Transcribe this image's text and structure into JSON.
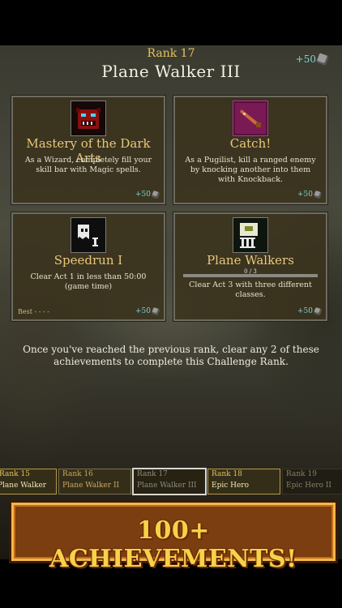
{
  "header": {
    "rank_label": "Rank 17",
    "title": "Plane Walker III",
    "points": "+50"
  },
  "achievements": [
    {
      "title": "Mastery of the Dark Arts",
      "desc": "As a Wizard, completely fill your skill bar with Magic spells.",
      "points": "+50",
      "icon": "demon-mask-icon"
    },
    {
      "title": "Catch!",
      "desc": "As a Pugilist, kill a ranged enemy by knocking another into them with Knockback.",
      "points": "+50",
      "icon": "thrown-dagger-icon"
    },
    {
      "title": "Speedrun I",
      "desc": "Clear Act 1 in less than 50:00 (game time)",
      "points": "+50",
      "best_label": "Best",
      "best_value": "- - - -",
      "icon": "ghost-runner-icon"
    },
    {
      "title": "Plane Walkers",
      "desc": "Clear Act 3 with three different classes.",
      "points": "+50",
      "progress": "0 / 3",
      "progress_fraction": 0,
      "icon": "three-heroes-icon"
    }
  ],
  "info": "Once you've reached the previous rank, clear any 2 of these achievements to complete this Challenge Rank.",
  "ranks": [
    {
      "rank": "Rank 15",
      "name": "Plane Walker",
      "state": "done"
    },
    {
      "rank": "Rank 16",
      "name": "Plane Walker II",
      "state": "done"
    },
    {
      "rank": "Rank 17",
      "name": "Plane Walker III",
      "state": "current"
    },
    {
      "rank": "Rank 18",
      "name": "Epic Hero",
      "state": "next"
    },
    {
      "rank": "Rank 19",
      "name": "Epic Hero II",
      "state": "future"
    }
  ],
  "banner": "100+ ACHIEVEMENTS!",
  "colors": {
    "gold": "#e2c25a",
    "cyan": "#7fd2d6",
    "card_bg": "#3a321c"
  }
}
